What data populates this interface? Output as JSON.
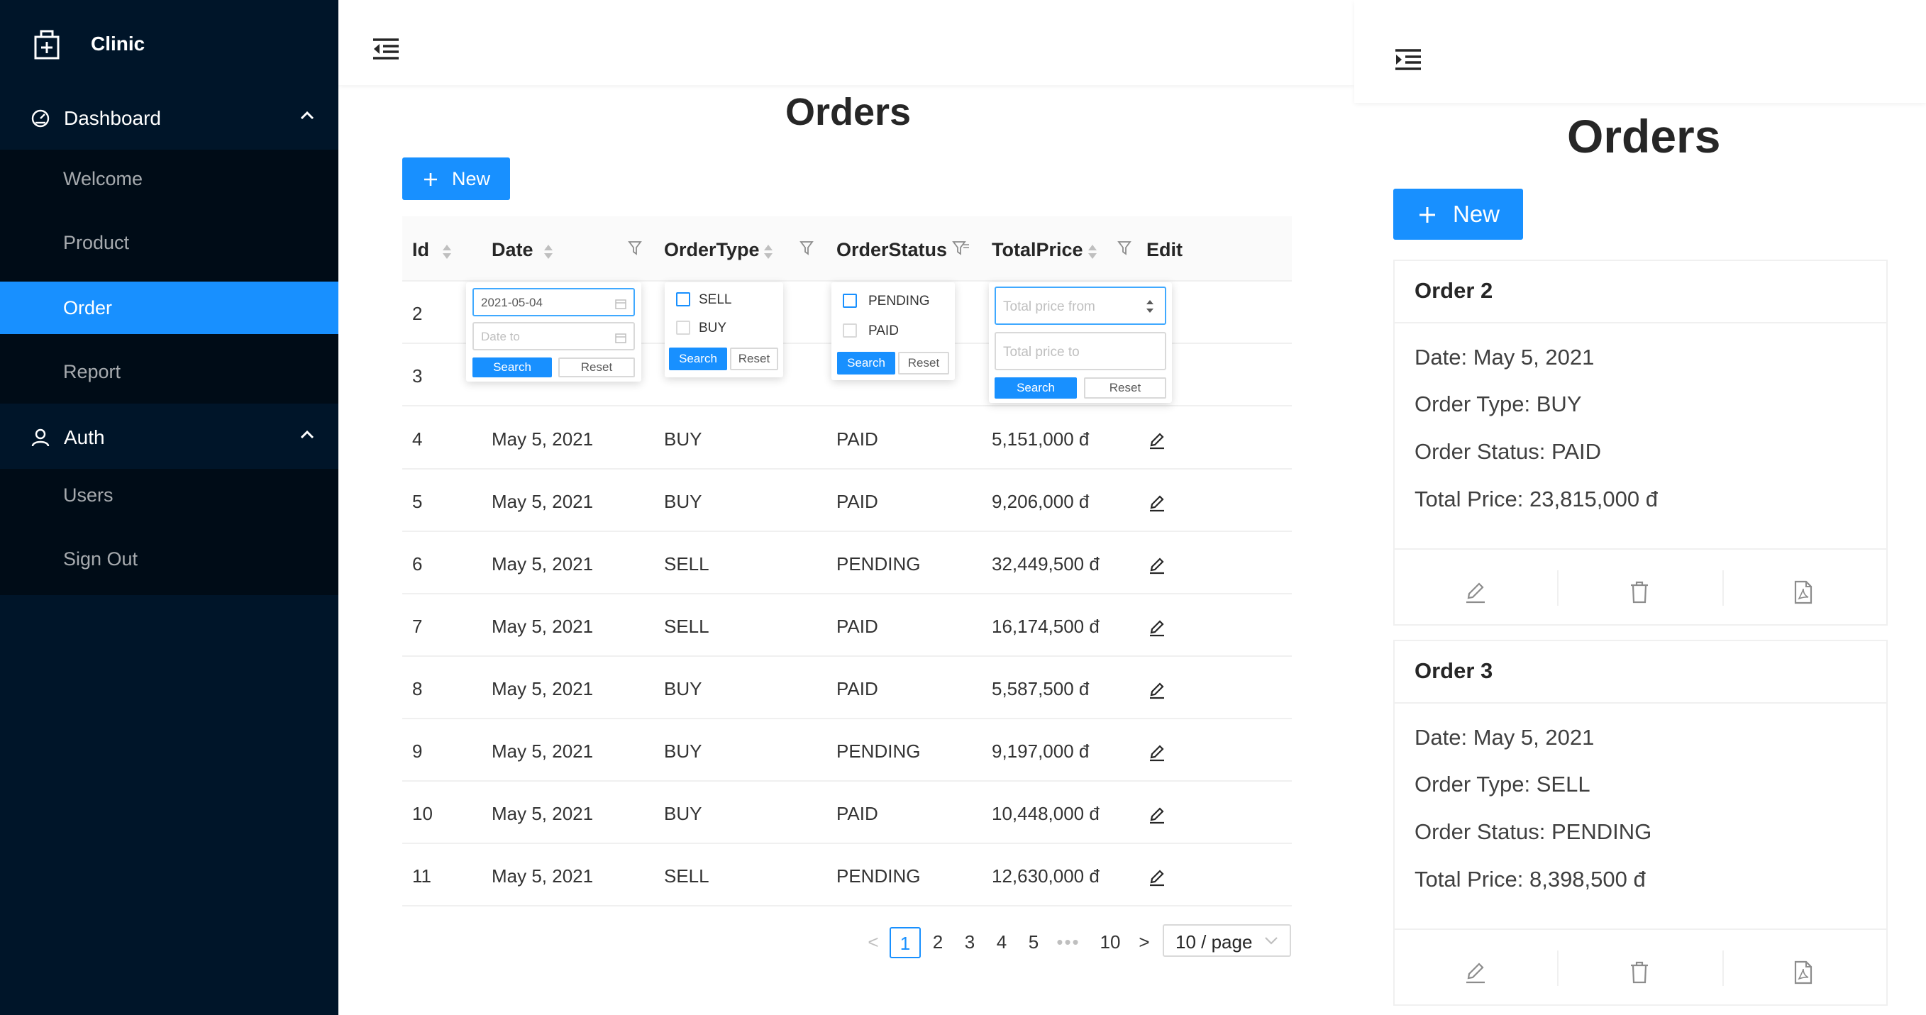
{
  "sidebar": {
    "brand": "Clinic",
    "groups": [
      {
        "label": "Dashboard",
        "icon": "dashboard-icon",
        "items": [
          "Welcome",
          "Product",
          "Order",
          "Report"
        ]
      },
      {
        "label": "Auth",
        "icon": "user-icon",
        "items": [
          "Users",
          "Sign Out"
        ]
      }
    ],
    "active_item": "Order"
  },
  "main": {
    "title": "Orders",
    "new_label": "New",
    "columns": [
      "Id",
      "Date",
      "OrderType",
      "OrderStatus",
      "TotalPrice",
      "Edit"
    ],
    "rows": [
      {
        "id": "2",
        "date": "",
        "type": "",
        "status": "",
        "price": ""
      },
      {
        "id": "3",
        "date": "",
        "type": "",
        "status": "",
        "price": ""
      },
      {
        "id": "4",
        "date": "May 5, 2021",
        "type": "BUY",
        "status": "PAID",
        "price": "5,151,000 đ"
      },
      {
        "id": "5",
        "date": "May 5, 2021",
        "type": "BUY",
        "status": "PAID",
        "price": "9,206,000 đ"
      },
      {
        "id": "6",
        "date": "May 5, 2021",
        "type": "SELL",
        "status": "PENDING",
        "price": "32,449,500 đ"
      },
      {
        "id": "7",
        "date": "May 5, 2021",
        "type": "SELL",
        "status": "PAID",
        "price": "16,174,500 đ"
      },
      {
        "id": "8",
        "date": "May 5, 2021",
        "type": "BUY",
        "status": "PAID",
        "price": "5,587,500 đ"
      },
      {
        "id": "9",
        "date": "May 5, 2021",
        "type": "BUY",
        "status": "PENDING",
        "price": "9,197,000 đ"
      },
      {
        "id": "10",
        "date": "May 5, 2021",
        "type": "BUY",
        "status": "PAID",
        "price": "10,448,000 đ"
      },
      {
        "id": "11",
        "date": "May 5, 2021",
        "type": "SELL",
        "status": "PENDING",
        "price": "12,630,000 đ"
      }
    ],
    "filters": {
      "date": {
        "from_value": "2021-05-04",
        "to_placeholder": "Date to",
        "search": "Search",
        "reset": "Reset"
      },
      "type": {
        "options": [
          "SELL",
          "BUY"
        ],
        "search": "Search",
        "reset": "Reset"
      },
      "status": {
        "options": [
          "PENDING",
          "PAID"
        ],
        "search": "Search",
        "reset": "Reset"
      },
      "price": {
        "from_placeholder": "Total price from",
        "to_placeholder": "Total price to",
        "search": "Search",
        "reset": "Reset"
      }
    },
    "pagination": {
      "pages": [
        "1",
        "2",
        "3",
        "4",
        "5",
        "•••",
        "10"
      ],
      "current": "1",
      "prev": "<",
      "next": ">",
      "page_size": "10 / page"
    }
  },
  "mobile": {
    "title": "Orders",
    "new_label": "New",
    "cards": [
      {
        "title": "Order 2",
        "date_label": "Date:",
        "date": "May 5, 2021",
        "type_label": "Order Type:",
        "type": "BUY",
        "status_label": "Order Status:",
        "status": "PAID",
        "price_label": "Total Price:",
        "price": "23,815,000 đ"
      },
      {
        "title": "Order 3",
        "date_label": "Date:",
        "date": "May 5, 2021",
        "type_label": "Order Type:",
        "type": "SELL",
        "status_label": "Order Status:",
        "status": "PENDING",
        "price_label": "Total Price:",
        "price": "8,398,500 đ"
      }
    ]
  },
  "colors": {
    "sidebar": "#001529",
    "submenu": "#000c17",
    "primary": "#1890ff",
    "border": "#f0f0f0"
  }
}
